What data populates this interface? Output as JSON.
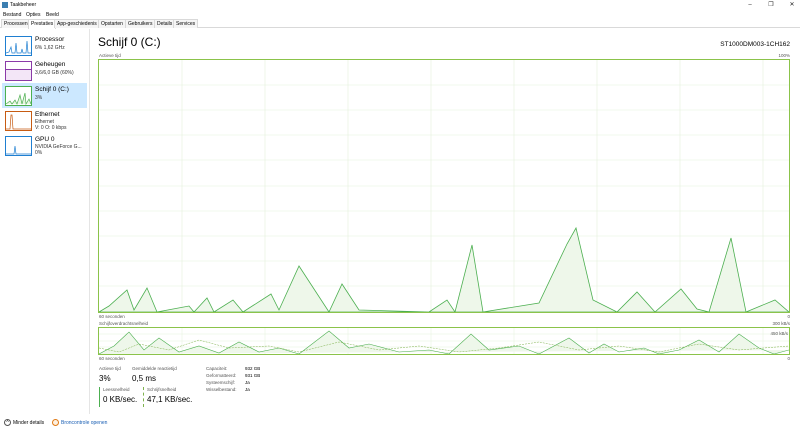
{
  "app": {
    "title": "Taakbeheer"
  },
  "menu": [
    "Bestand",
    "Opties",
    "Beeld"
  ],
  "tabs": [
    "Processen",
    "Prestaties",
    "App-geschiedenis",
    "Opstarten",
    "Gebruikers",
    "Details",
    "Services"
  ],
  "active_tab": "Prestaties",
  "sidebar": [
    {
      "name": "Processor",
      "lines": [
        "6% 1,62 GHz"
      ],
      "color": "#1f7fd1"
    },
    {
      "name": "Geheugen",
      "lines": [
        "3,6/6,0 GB (60%)"
      ],
      "color": "#8b3aa8"
    },
    {
      "name": "Schijf 0 (C:)",
      "lines": [
        "3%"
      ],
      "color": "#4caf50"
    },
    {
      "name": "Ethernet",
      "lines": [
        "Ethernet",
        "V: 0 O: 0 kbps"
      ],
      "color": "#c75b12"
    },
    {
      "name": "GPU 0",
      "lines": [
        "NVIDIA GeForce G...",
        "0%"
      ],
      "color": "#1f7fd1"
    }
  ],
  "main": {
    "title": "Schijf 0 (C:)",
    "model": "ST1000DM003-1CH162",
    "graph1": {
      "top_label": "Actieve tijd",
      "top_right": "100%",
      "bottom_left": "60 seconden",
      "bottom_right": "0"
    },
    "graph2": {
      "top_label": "Schijfoverdrachtsnelheid",
      "top_right": "300 kB/s",
      "mid_right": "450 kB/s",
      "bottom_left": "60 seconden",
      "bottom_right": "0"
    }
  },
  "stats": {
    "active_time_label": "Actieve tijd",
    "active_time": "3%",
    "response_label": "Gemiddelde reactietijd",
    "response": "0,5 ms",
    "read_label": "Leessnelheid",
    "read": "0 KB/sec.",
    "write_label": "Schrijfsnelheid",
    "write": "47,1 KB/sec."
  },
  "properties": [
    {
      "key": "Capaciteit:",
      "value": "932 GB"
    },
    {
      "key": "Geformatteerd:",
      "value": "931 GB"
    },
    {
      "key": "Systeemschijf:",
      "value": "Ja"
    },
    {
      "key": "Wisselbestand:",
      "value": "Ja"
    }
  ],
  "footer": {
    "less_details": "Minder details",
    "resource_monitor": "Broncontrole openen"
  },
  "colors": {
    "accent_green": "#4caf50",
    "selected_bg": "#cce8ff"
  }
}
